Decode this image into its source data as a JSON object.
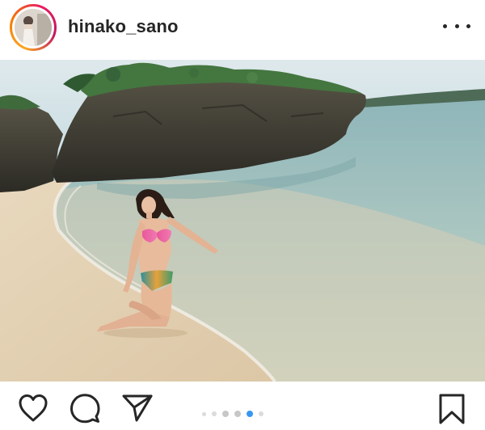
{
  "post": {
    "username": "hinako_sano",
    "avatar_icon": "profile-photo",
    "more_icon": "more-horizontal-icon"
  },
  "photo": {
    "subject": "beach-photo"
  },
  "actions": {
    "like_icon": "heart-icon",
    "comment_icon": "comment-icon",
    "share_icon": "send-icon",
    "save_icon": "bookmark-icon"
  },
  "carousel": {
    "count": 6,
    "active_index": 4,
    "active_color": "#3897f0",
    "inactive_color": "#dbdbdb"
  }
}
